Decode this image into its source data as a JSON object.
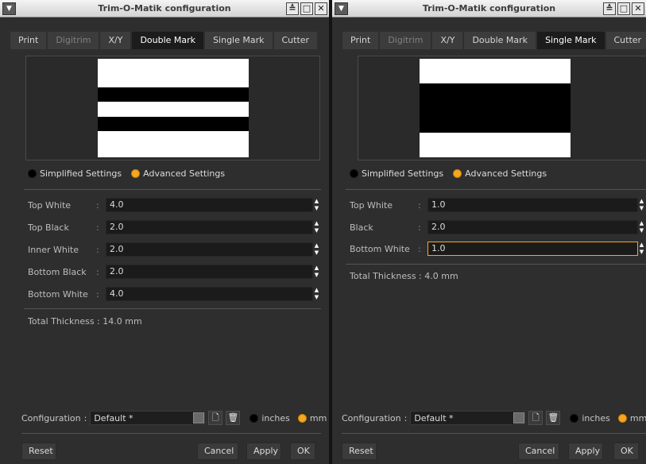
{
  "windows": [
    {
      "title": "Trim-O-Matik configuration",
      "tabs": [
        "Print",
        "Digitrim",
        "X/Y",
        "Double Mark",
        "Single Mark",
        "Cutter"
      ],
      "active_tab": "Double Mark",
      "modes": [
        "Simplified Settings",
        "Advanced Settings"
      ],
      "selected_mode": "Advanced Settings",
      "fields": [
        {
          "label": "Top White",
          "value": "4.0"
        },
        {
          "label": "Top Black",
          "value": "2.0"
        },
        {
          "label": "Inner White",
          "value": "2.0"
        },
        {
          "label": "Bottom Black",
          "value": "2.0"
        },
        {
          "label": "Bottom White",
          "value": "4.0"
        }
      ],
      "total_label": "Total Thickness",
      "total_value": "14.0 mm",
      "configuration_label": "Configuration",
      "configuration_value": "Default *",
      "units": [
        "inches",
        "mm"
      ],
      "selected_unit": "mm",
      "buttons": {
        "reset": "Reset",
        "cancel": "Cancel",
        "apply": "Apply",
        "ok": "OK"
      }
    },
    {
      "title": "Trim-O-Matik configuration",
      "tabs": [
        "Print",
        "Digitrim",
        "X/Y",
        "Double Mark",
        "Single Mark",
        "Cutter"
      ],
      "active_tab": "Single Mark",
      "modes": [
        "Simplified Settings",
        "Advanced Settings"
      ],
      "selected_mode": "Advanced Settings",
      "fields": [
        {
          "label": "Top White",
          "value": "1.0"
        },
        {
          "label": "Black",
          "value": "2.0"
        },
        {
          "label": "Bottom White",
          "value": "1.0"
        }
      ],
      "total_label": "Total Thickness",
      "total_value": "4.0 mm",
      "configuration_label": "Configuration",
      "configuration_value": "Default *",
      "units": [
        "inches",
        "mm"
      ],
      "selected_unit": "mm",
      "buttons": {
        "reset": "Reset",
        "cancel": "Cancel",
        "apply": "Apply",
        "ok": "OK"
      }
    }
  ],
  "colors": {
    "accent": "#f7a71f",
    "background": "#2e2e2e",
    "field": "#1b1b1b"
  }
}
